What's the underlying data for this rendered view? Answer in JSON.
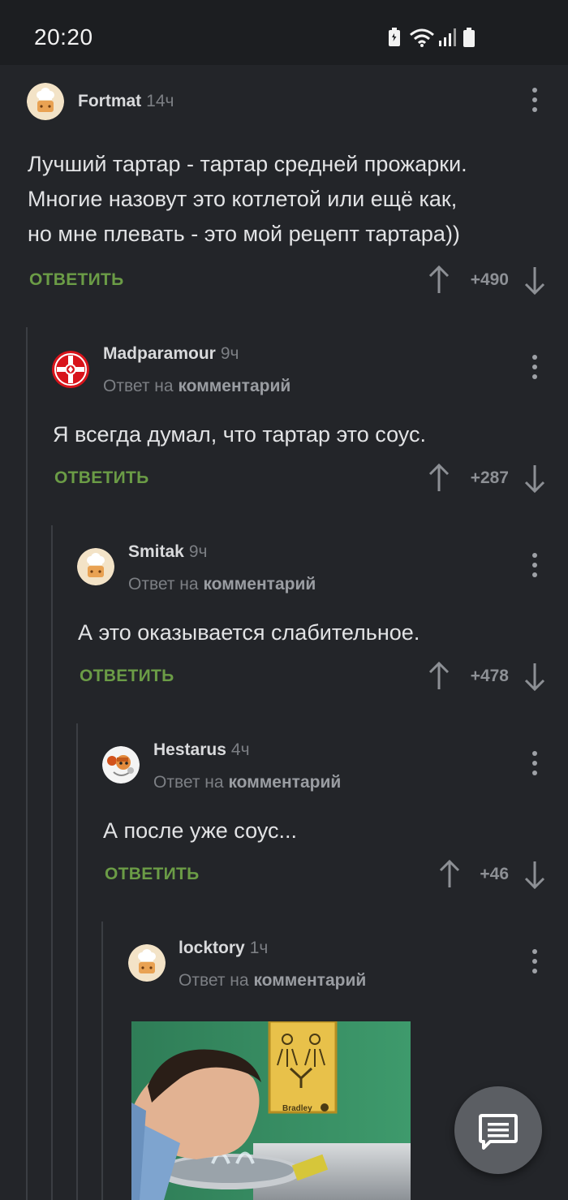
{
  "status_bar": {
    "time": "20:20",
    "icons": [
      "battery-saver-icon",
      "wifi-icon",
      "signal-icon",
      "battery-icon"
    ]
  },
  "comments": [
    {
      "author": "Fortmat",
      "time": "14ч",
      "text_lines": [
        "Лучший тартар - тартар средней прожарки.",
        "Многие назовут это котлетой или ещё как,",
        "но мне плевать - это мой рецепт тартара))"
      ],
      "reply_label": "ОТВЕТИТЬ",
      "score": "+490",
      "avatar": "chef-hat-avatar"
    },
    {
      "author": "Madparamour",
      "time": "9ч",
      "reply_prefix": "Ответ на",
      "reply_target": "комментарий",
      "text_lines": [
        "Я всегда думал, что тартар это соус."
      ],
      "reply_label": "ОТВЕТИТЬ",
      "score": "+287",
      "avatar": "red-cross-avatar"
    },
    {
      "author": "Smitak",
      "time": "9ч",
      "reply_prefix": "Ответ на",
      "reply_target": "комментарий",
      "text_lines": [
        "А это оказывается слабительное."
      ],
      "reply_label": "ОТВЕТИТЬ",
      "score": "+478",
      "avatar": "chef-hat-avatar"
    },
    {
      "author": "Hestarus",
      "time": "4ч",
      "reply_prefix": "Ответ на",
      "reply_target": "комментарий",
      "text_lines": [
        "А после уже соус..."
      ],
      "reply_label": "ОТВЕТИТЬ",
      "score": "+46",
      "avatar": "cartoon-avatar"
    },
    {
      "author": "locktory",
      "time": "1ч",
      "reply_prefix": "Ответ на",
      "reply_target": "комментарий",
      "avatar": "chef-hat-avatar",
      "image": {
        "sign_text": "Bradley",
        "alt": "eyewash-station-photo"
      }
    }
  ],
  "colors": {
    "background": "#232529",
    "reply_green": "#6b9c46",
    "muted": "#7c7f84"
  },
  "fab": {
    "icon": "comment-icon"
  }
}
